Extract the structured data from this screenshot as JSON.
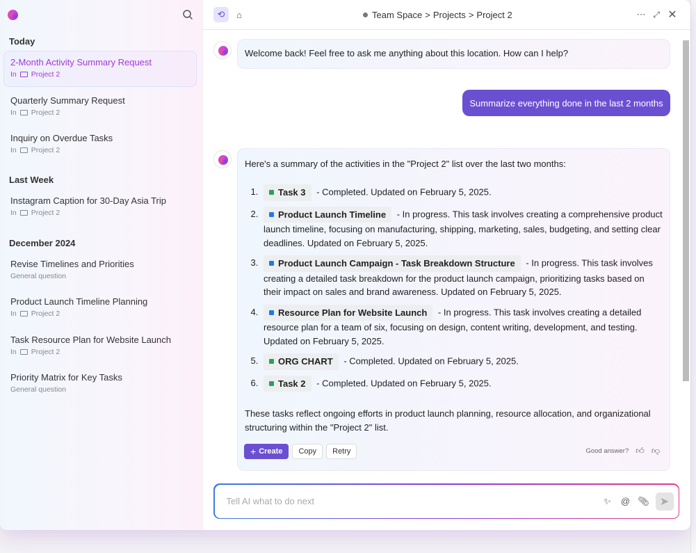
{
  "sidebar": {
    "sections": [
      {
        "title": "Today",
        "items": [
          {
            "title": "2-Month Activity Summary Request",
            "prefix": "In",
            "location": "Project 2",
            "active": true
          },
          {
            "title": "Quarterly Summary Request",
            "prefix": "In",
            "location": "Project 2"
          },
          {
            "title": "Inquiry on Overdue Tasks",
            "prefix": "In",
            "location": "Project 2"
          }
        ]
      },
      {
        "title": "Last Week",
        "items": [
          {
            "title": "Instagram Caption for 30-Day Asia Trip",
            "prefix": "In",
            "location": "Project 2"
          }
        ]
      },
      {
        "title": "December 2024",
        "items": [
          {
            "title": "Revise Timelines and Priorities",
            "sub": "General question"
          },
          {
            "title": "Product Launch Timeline Planning",
            "prefix": "In",
            "location": "Project 2"
          },
          {
            "title": "Task Resource Plan for Website Launch",
            "prefix": "In",
            "location": "Project 2"
          },
          {
            "title": "Priority Matrix for Key Tasks",
            "sub": "General question"
          }
        ]
      }
    ]
  },
  "header": {
    "breadcrumb": [
      "Team Space",
      ">",
      "Projects",
      ">",
      "Project 2"
    ]
  },
  "chat": {
    "welcome": "Welcome back! Feel free to ask me anything about this location. How can I help?",
    "user_message": "Summarize everything done in the last 2 months",
    "reply_intro": "Here's a summary of the activities in the \"Project 2\" list over the last two months:",
    "items": [
      {
        "name": "Task 3",
        "color": "#2e9e5b",
        "text": "- Completed. Updated on February 5, 2025."
      },
      {
        "name": "Product Launch Timeline",
        "color": "#1f7ae0",
        "text": "- In progress. This task involves creating a comprehensive product launch timeline, focusing on manufacturing, shipping, marketing, sales, budgeting, and setting clear deadlines. Updated on February 5, 2025."
      },
      {
        "name": "Product Launch Campaign - Task Breakdown Structure",
        "color": "#1f7ae0",
        "text": "- In progress. This task involves creating a detailed task breakdown for the product launch campaign, prioritizing tasks based on their impact on sales and brand awareness. Updated on February 5, 2025."
      },
      {
        "name": "Resource Plan for Website Launch",
        "color": "#1f7ae0",
        "text": "- In progress. This task involves creating a detailed resource plan for a team of six, focusing on design, content writing, development, and testing. Updated on February 5, 2025."
      },
      {
        "name": "ORG CHART",
        "color": "#2e9e5b",
        "text": "- Completed. Updated on February 5, 2025."
      },
      {
        "name": "Task 2",
        "color": "#2e9e5b",
        "text": "- Completed. Updated on February 5, 2025."
      }
    ],
    "reply_outro": "These tasks reflect ongoing efforts in product launch planning, resource allocation, and organizational structuring within the \"Project 2\" list.",
    "actions": {
      "create": "Create",
      "copy": "Copy",
      "retry": "Retry"
    },
    "feedback": "Good answer?"
  },
  "input": {
    "placeholder": "Tell AI what to do next",
    "value": ""
  }
}
